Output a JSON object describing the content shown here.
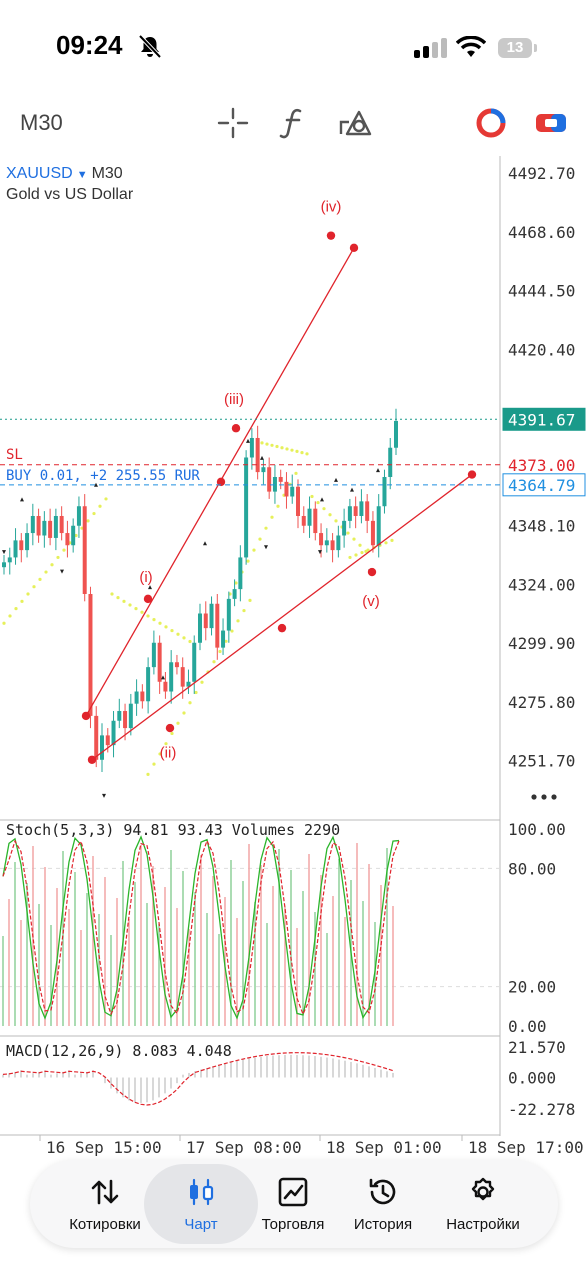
{
  "status": {
    "time": "09:24",
    "battery": "13"
  },
  "toolbar": {
    "timeframe": "M30",
    "icons": [
      "crosshair-icon",
      "function-icon",
      "objects-icon",
      "trade-ring-icon",
      "one-click-icon"
    ]
  },
  "chart": {
    "symbol": "XAUUSD",
    "timeframe": "M30",
    "description": "Gold vs US Dollar",
    "sl_label": "SL",
    "position_label": "BUY 0.01, +2 255.55 RUR",
    "price_labels": [
      "4492.70",
      "4468.60",
      "4444.50",
      "4420.40",
      "4348.10",
      "4324.00",
      "4299.90",
      "4275.80",
      "4251.70"
    ],
    "current_price": "4391.67",
    "sl_price": "4373.00",
    "open_price": "4364.79",
    "wave_labels": [
      "(i)",
      "(ii)",
      "(iii)",
      "(iv)",
      "(v)"
    ],
    "stoch_label": "Stoch(5,3,3) 94.81 93.43 Volumes 2290",
    "stoch_levels": [
      "100.00",
      "80.00",
      "20.00",
      "0.00"
    ],
    "macd_label": "MACD(12,26,9) 8.083 4.048",
    "macd_levels": [
      "21.570",
      "0.000",
      "-22.278"
    ],
    "time_labels": [
      "16 Sep 15:00",
      "17 Sep 08:00",
      "18 Sep 01:00",
      "18 Sep 17:00"
    ],
    "colors": {
      "bull": "#26a69a",
      "bear": "#ef5350",
      "line": "#e0242c",
      "sar": "#e6f05a",
      "link": "#1f6fe0",
      "stoch_main": "#2bb52b",
      "stoch_signal": "#e0242c"
    }
  },
  "tabs": [
    {
      "label": "Котировки",
      "icon": "quotes-icon"
    },
    {
      "label": "Чарт",
      "icon": "chart-icon"
    },
    {
      "label": "Торговля",
      "icon": "trade-icon"
    },
    {
      "label": "История",
      "icon": "history-icon"
    },
    {
      "label": "Настройки",
      "icon": "settings-icon"
    }
  ]
}
